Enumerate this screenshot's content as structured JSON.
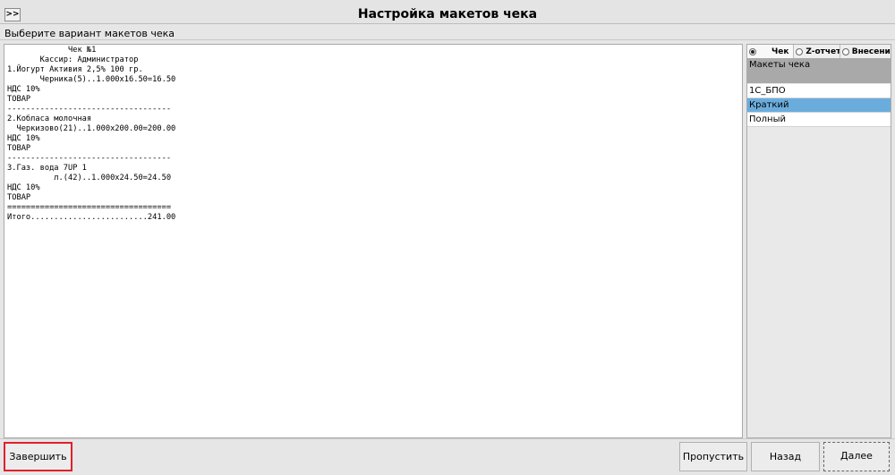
{
  "header": {
    "toggle_label": ">>",
    "title": "Настройка макетов чека",
    "subtitle": "Выберите вариант макетов чека"
  },
  "receipt": {
    "lines": [
      "             Чек №1",
      "       Кассир: Администратор",
      "1.Йогурт Активия 2,5% 100 гр.",
      "       Черника(5)..1.000x16.50=16.50",
      "НДС 10%",
      "ТОВАР",
      "-----------------------------------",
      "2.Кобласа молочная",
      "  Черкизово(21)..1.000x200.00=200.00",
      "НДС 10%",
      "ТОВАР",
      "-----------------------------------",
      "3.Газ. вода 7UP 1",
      "          л.(42)..1.000x24.50=24.50",
      "НДС 10%",
      "ТОВАР",
      "===================================",
      "Итого.........................241.00"
    ]
  },
  "side": {
    "radios": [
      {
        "label": "Чек",
        "selected": true
      },
      {
        "label": "Z-отчет",
        "selected": false
      },
      {
        "label": "Внесение",
        "selected": false
      }
    ],
    "list_header": "Макеты чека",
    "items": [
      {
        "label": "1С_БПО",
        "selected": false
      },
      {
        "label": "Краткий",
        "selected": true
      },
      {
        "label": "Полный",
        "selected": false
      }
    ]
  },
  "buttons": {
    "finish": "Завершить",
    "skip": "Пропустить",
    "back": "Назад",
    "next": "Далее"
  },
  "colors": {
    "selected_item": "#6aaddd",
    "finish_highlight": "#e0202a"
  }
}
